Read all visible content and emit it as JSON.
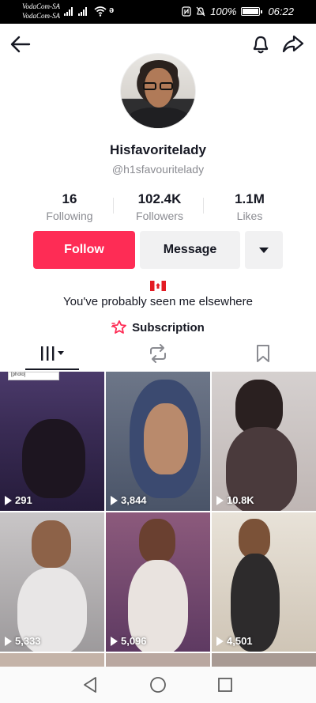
{
  "status_bar": {
    "carrier_1": "VodaCom-SA",
    "carrier_2": "VodaCom-SA",
    "notification_icon": "ǝ",
    "battery_percent": "100%",
    "time": "06:22"
  },
  "profile": {
    "display_name": "Hisfavoritelady",
    "username": "@h1sfavouritelady",
    "bio": "You've probably seen me elsewhere",
    "subscription_label": "Subscription"
  },
  "stats": [
    {
      "value": "16",
      "label": "Following"
    },
    {
      "value": "102.4K",
      "label": "Followers"
    },
    {
      "value": "1.1M",
      "label": "Likes"
    }
  ],
  "actions": {
    "follow_label": "Follow",
    "message_label": "Message"
  },
  "videos": [
    {
      "views": "291",
      "tag": "[photo]"
    },
    {
      "views": "3,844"
    },
    {
      "views": "10.8K"
    },
    {
      "views": "5,333"
    },
    {
      "views": "5,096"
    },
    {
      "views": "4,501"
    }
  ],
  "colors": {
    "accent": "#fe2c55",
    "secondary_button": "#f1f1f2",
    "muted_text": "#8a8b91"
  },
  "icons": [
    "back-arrow-icon",
    "bell-icon",
    "share-icon",
    "grid-icon",
    "repost-icon",
    "bookmark-icon",
    "subscription-star-icon",
    "play-icon",
    "nav-back-icon",
    "nav-home-icon",
    "nav-recents-icon"
  ]
}
